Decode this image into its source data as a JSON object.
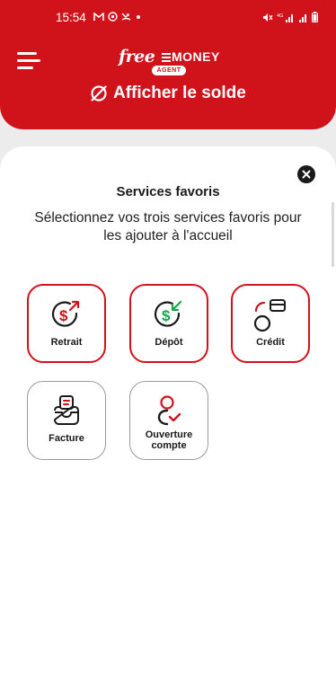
{
  "status_bar": {
    "time": "15:54",
    "network": "4G"
  },
  "header": {
    "logo": {
      "brand_left": "free",
      "brand_right": "MONEY",
      "badge": "AGENT"
    },
    "balance_label": "Afficher le solde"
  },
  "dialog": {
    "title": "Services favoris",
    "subtitle": "Sélectionnez vos trois services favoris pour les ajouter à l'accueil",
    "services": [
      {
        "label": "Retrait",
        "icon": "withdraw-icon",
        "selected": true
      },
      {
        "label": "Dépôt",
        "icon": "deposit-icon",
        "selected": true
      },
      {
        "label": "Crédit",
        "icon": "credit-icon",
        "selected": true
      },
      {
        "label": "Facture",
        "icon": "invoice-icon",
        "selected": false
      },
      {
        "label": "Ouverture\ncompte",
        "icon": "account-opening-icon",
        "selected": false
      }
    ]
  },
  "colors": {
    "brand_red": "#d0121b",
    "deposit_green": "#1aa64a",
    "unselected_border": "#9a9a9a"
  }
}
